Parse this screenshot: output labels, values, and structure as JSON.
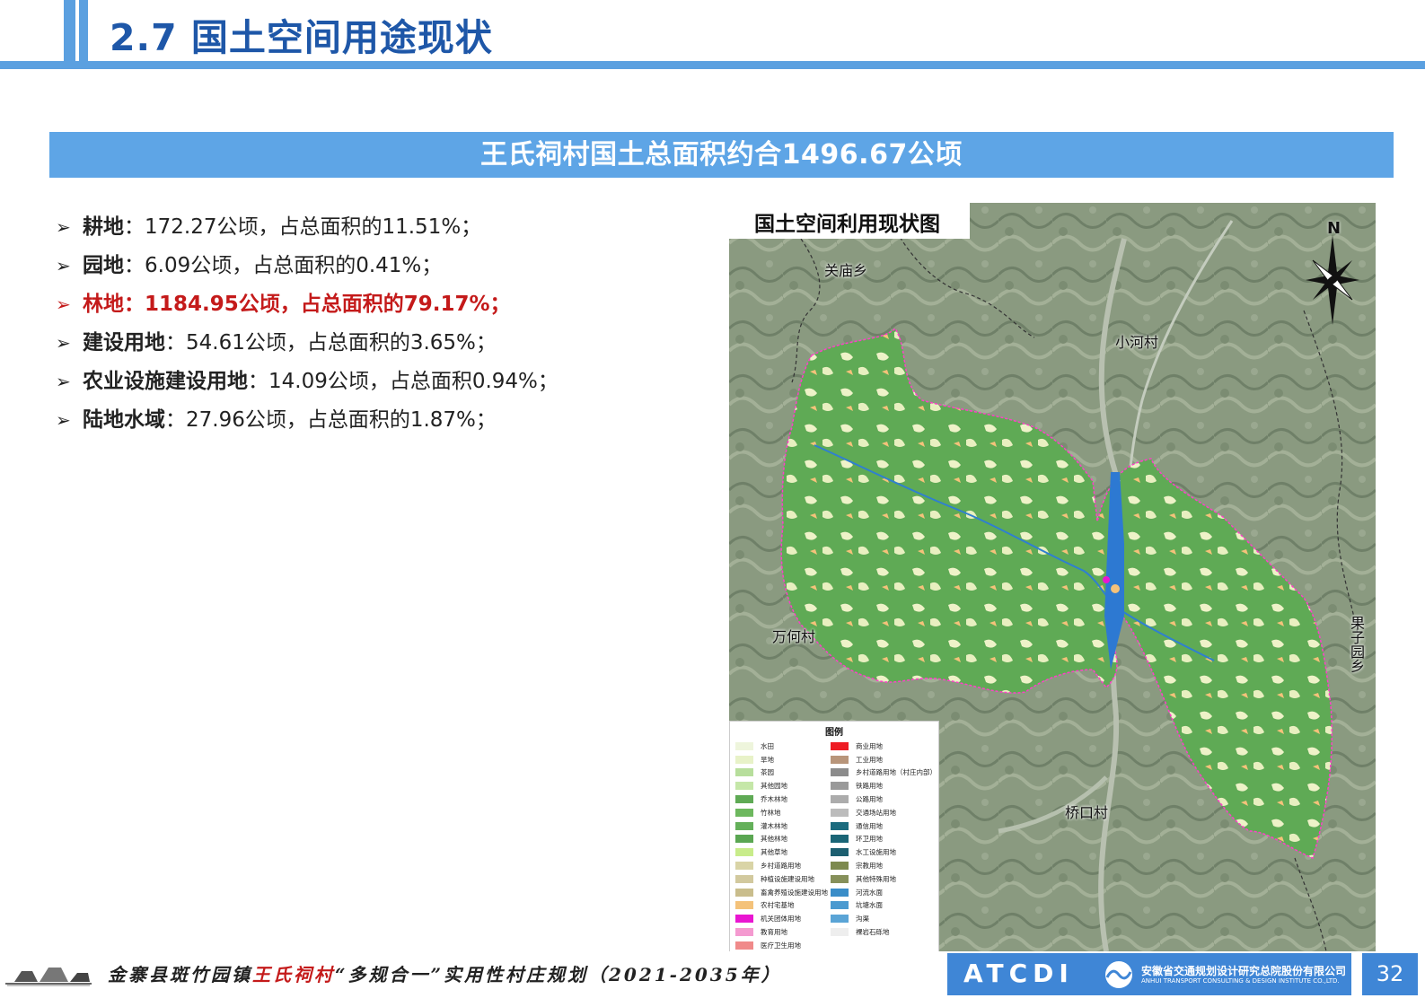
{
  "header": {
    "title": "2.7 国土空间用途现状"
  },
  "banner": {
    "text": "王氏祠村国土总面积约合1496.67公顷"
  },
  "items": [
    {
      "label": "耕地",
      "sep": "：",
      "text": "172.27公顷，占总面积的11.51%；",
      "highlight": false
    },
    {
      "label": "园地",
      "sep": "：",
      "text": "6.09公顷，占总面积的0.41%；",
      "highlight": false
    },
    {
      "label": "林地",
      "sep": "：",
      "text": "1184.95公顷，占总面积的79.17%；",
      "highlight": true
    },
    {
      "label": "建设用地",
      "sep": "：",
      "text": "54.61公顷，占总面积的3.65%；",
      "highlight": false
    },
    {
      "label": "农业设施建设用地",
      "sep": "：",
      "text": "14.09公顷，占总面积0.94%；",
      "highlight": false
    },
    {
      "label": "陆地水域",
      "sep": "：",
      "text": "27.96公顷，占总面积的1.87%；",
      "highlight": false
    }
  ],
  "map": {
    "title": "国土空间利用现状图",
    "compass_letter": "N",
    "villages": [
      "关庙乡",
      "小河村",
      "万何村",
      "果子园乡",
      "桥口村"
    ],
    "legend_title": "图例",
    "legend_left": [
      {
        "label": "水田",
        "color": "#eef5dc"
      },
      {
        "label": "旱地",
        "color": "#e8f2c8"
      },
      {
        "label": "茶园",
        "color": "#b7de9c"
      },
      {
        "label": "其他园地",
        "color": "#c5e7a8"
      },
      {
        "label": "乔木林地",
        "color": "#5faa55"
      },
      {
        "label": "竹林地",
        "color": "#6db85e"
      },
      {
        "label": "灌木林地",
        "color": "#64b05a"
      },
      {
        "label": "其他林地",
        "color": "#5aa652"
      },
      {
        "label": "其他草地",
        "color": "#c8ec8a"
      },
      {
        "label": "乡村道路用地",
        "color": "#d9d4a6"
      },
      {
        "label": "种植设施建设用地",
        "color": "#d2c99e"
      },
      {
        "label": "畜禽养殖设施建设用地",
        "color": "#c9bd8c"
      },
      {
        "label": "农村宅基地",
        "color": "#f4c27a"
      },
      {
        "label": "机关团体用地",
        "color": "#e916d1"
      },
      {
        "label": "教育用地",
        "color": "#f49ad0"
      },
      {
        "label": "医疗卫生用地",
        "color": "#f08a8a"
      }
    ],
    "legend_right": [
      {
        "label": "商业用地",
        "color": "#ee1c24"
      },
      {
        "label": "工业用地",
        "color": "#b8957a"
      },
      {
        "label": "乡村道路用地（村庄内部）",
        "color": "#8c8c8c"
      },
      {
        "label": "铁路用地",
        "color": "#9a9a9a"
      },
      {
        "label": "公路用地",
        "color": "#acacac"
      },
      {
        "label": "交通场站用地",
        "color": "#bcbcbc"
      },
      {
        "label": "通信用地",
        "color": "#1b6b7e"
      },
      {
        "label": "环卫用地",
        "color": "#1a6576"
      },
      {
        "label": "水工设施用地",
        "color": "#1d5f70"
      },
      {
        "label": "宗教用地",
        "color": "#7d8a4e"
      },
      {
        "label": "其他特殊用地",
        "color": "#86905a"
      },
      {
        "label": "河流水面",
        "color": "#3a8dc8"
      },
      {
        "label": "坑塘水面",
        "color": "#4b9ad0"
      },
      {
        "label": "沟渠",
        "color": "#5aa4d6"
      },
      {
        "label": "裸岩石砾地",
        "color": "#eeeeee"
      }
    ]
  },
  "footer": {
    "text_before": "金寨县斑竹园镇",
    "text_red": "王氏祠村",
    "text_after": "“多规合一”实用性村庄规划（2021-2035年）",
    "org_logo": "ATCDI",
    "org_cn": "安徽省交通规划设计研究总院股份有限公司",
    "org_en": "ANHUI TRANSPORT CONSULTING & DESIGN INSTITUTE CO.,LTD.",
    "page_number": "32"
  }
}
